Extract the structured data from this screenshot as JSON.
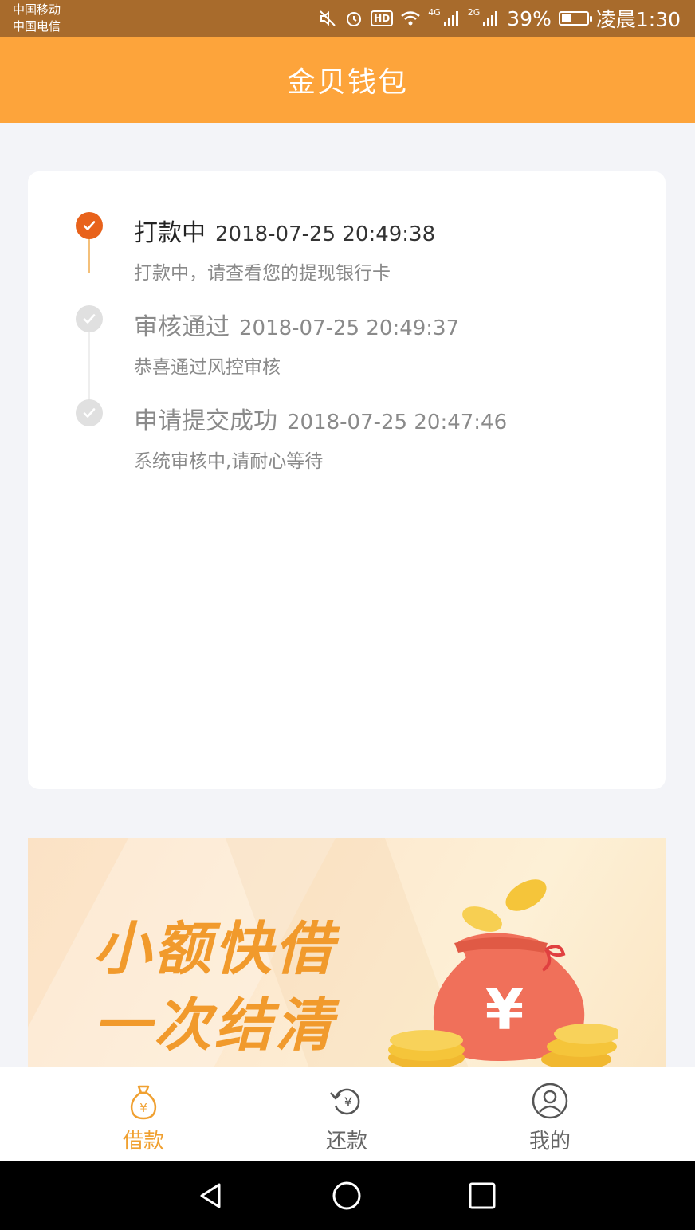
{
  "status_bar": {
    "carrier1": "中国移动",
    "carrier2": "中国电信",
    "signal1": "4G",
    "signal2": "2G",
    "battery": "39%",
    "battery_level": 0.39,
    "time": "凌晨1:30",
    "icons": [
      "mute-icon",
      "alarm-icon",
      "hd-icon",
      "wifi-icon",
      "signal-icon",
      "signal-icon",
      "battery-icon"
    ]
  },
  "header": {
    "title": "金贝钱包",
    "color": "#fda43b"
  },
  "timeline": {
    "steps": [
      {
        "title": "打款中",
        "time": "2018-07-25 20:49:38",
        "desc": "打款中，请查看您的提现银行卡",
        "active": true
      },
      {
        "title": "审核通过",
        "time": "2018-07-25 20:49:37",
        "desc": "恭喜通过风控审核",
        "active": false
      },
      {
        "title": "申请提交成功",
        "time": "2018-07-25 20:47:46",
        "desc": "系统审核中,请耐心等待",
        "active": false
      }
    ]
  },
  "banner": {
    "line1": "小额快借",
    "line2": "一次结清",
    "bag_symbol": "¥"
  },
  "tabs": [
    {
      "label": "借款",
      "icon": "money-bag-icon",
      "active": true
    },
    {
      "label": "还款",
      "icon": "repay-icon",
      "active": false
    },
    {
      "label": "我的",
      "icon": "user-icon",
      "active": false
    }
  ],
  "colors": {
    "accent": "#f0a030",
    "active_dot": "#e8621b",
    "inactive_dot": "#e0e0e0"
  }
}
